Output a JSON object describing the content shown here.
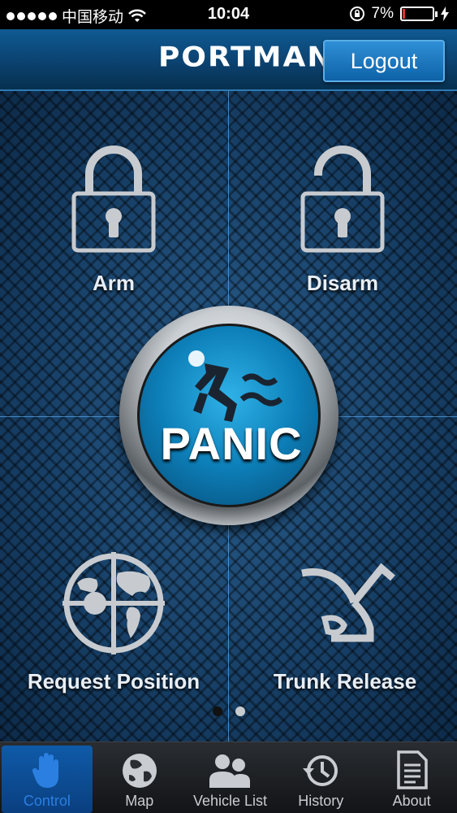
{
  "status_bar": {
    "carrier": "中国移动",
    "time": "10:04",
    "battery": "7%",
    "battery_level": 0.07
  },
  "header": {
    "brand": "PORTMAN",
    "logout_label": "Logout"
  },
  "controls": {
    "arm_label": "Arm",
    "disarm_label": "Disarm",
    "panic_label": "PANIC",
    "request_position_label": "Request Position",
    "trunk_release_label": "Trunk Release"
  },
  "pager": {
    "current": 1,
    "total": 2
  },
  "tabs": [
    {
      "label": "Control",
      "icon": "hand-icon",
      "active": true
    },
    {
      "label": "Map",
      "icon": "globe-icon",
      "active": false
    },
    {
      "label": "Vehicle List",
      "icon": "people-icon",
      "active": false
    },
    {
      "label": "History",
      "icon": "history-icon",
      "active": false
    },
    {
      "label": "About",
      "icon": "document-icon",
      "active": false
    }
  ],
  "colors": {
    "header": "#0b4270",
    "accent": "#2b7fe0",
    "panic": "#0d7fb8"
  }
}
